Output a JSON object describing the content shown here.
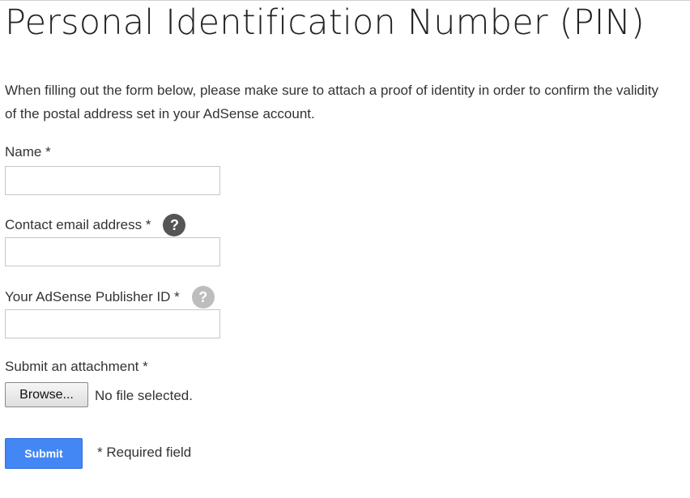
{
  "page": {
    "title": "Personal Identification Number (PIN)",
    "intro": "When filling out the form below, please make sure to attach a proof of identity in order to confirm the validity of the postal address set in your AdSense account."
  },
  "form": {
    "name": {
      "label": "Name *",
      "value": ""
    },
    "email": {
      "label": "Contact email address *",
      "value": "",
      "help_icon": "question-mark-icon",
      "help_glyph": "?"
    },
    "publisher_id": {
      "label": "Your AdSense Publisher ID *",
      "value": "",
      "help_icon": "question-mark-icon",
      "help_glyph": "?"
    },
    "attachment": {
      "label": "Submit an attachment *",
      "browse_label": "Browse...",
      "file_status": "No file selected."
    },
    "submit_label": "Submit",
    "required_note": "* Required field"
  },
  "colors": {
    "submit_blue": "#4387f4",
    "help_dark": "#555555",
    "help_light": "#bdbdbd"
  }
}
